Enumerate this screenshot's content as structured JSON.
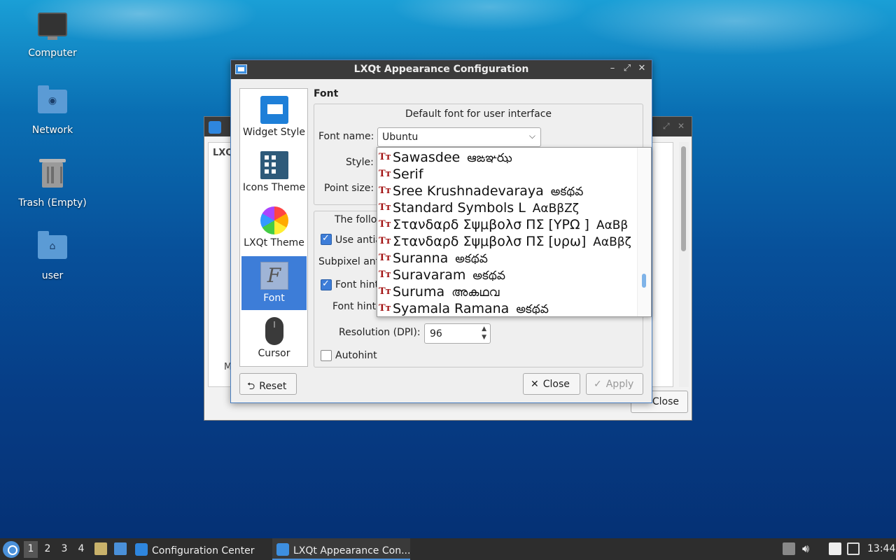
{
  "desktop": {
    "icons": [
      {
        "label": "Computer"
      },
      {
        "label": "Network"
      },
      {
        "label": "Trash (Empty)"
      },
      {
        "label": "user"
      }
    ]
  },
  "back_window": {
    "title_text": "LXQ",
    "label_m": "M",
    "close_label": "Close"
  },
  "dialog": {
    "title": "LXQt Appearance Configuration",
    "controls": {
      "minimize": "–",
      "maximize": "⤢",
      "close": "✕"
    },
    "sidebar": [
      {
        "label": "Widget Style",
        "icon": "widget-style-icon"
      },
      {
        "label": "Icons Theme",
        "icon": "icons-theme-icon"
      },
      {
        "label": "LXQt Theme",
        "icon": "lxqt-theme-icon"
      },
      {
        "label": "Font",
        "icon": "font-icon",
        "selected": true
      },
      {
        "label": "Cursor",
        "icon": "cursor-icon"
      }
    ],
    "section_title": "Font",
    "default_font_group": "Default font for user interface",
    "font_name_label": "Font name:",
    "font_name_value": "Ubuntu",
    "style_label": "Style:",
    "point_size_label": "Point size:",
    "following_text": "The follo",
    "use_antialias_label": "Use antia",
    "use_antialias_checked": true,
    "subpixel_label": "Subpixel ant",
    "font_hinting_label": "Font hint",
    "font_hinting_checked": true,
    "font_hint_style_label": "Font hint",
    "resolution_label": "Resolution (DPI):",
    "resolution_value": "96",
    "autohint_label": "Autohint",
    "autohint_checked": false,
    "reset_label": "Reset",
    "close_label": "Close",
    "apply_label": "Apply",
    "font_list": [
      {
        "name": "Sawasdee",
        "sample": "ఆఙఞఝ"
      },
      {
        "name": "Serif",
        "sample": ""
      },
      {
        "name": "Sree Krushnadevaraya",
        "sample": "అకథవ"
      },
      {
        "name": "Standard Symbols L",
        "sample": "ΑαΒβΖζ"
      },
      {
        "name": "Στανδαρδ Σψμβολσ ΠΣ [ΥΡΩ ]",
        "sample": "ΑαΒβ"
      },
      {
        "name": "Στανδαρδ Σψμβολσ ΠΣ [υρω]",
        "sample": "ΑαΒβζ"
      },
      {
        "name": "Suranna",
        "sample": "అకథవ"
      },
      {
        "name": "Suravaram",
        "sample": "అకథవ"
      },
      {
        "name": "Suruma",
        "sample": "അകഥവ"
      },
      {
        "name": "Syamala Ramana",
        "sample": "అకథవ"
      }
    ]
  },
  "taskbar": {
    "desktops": [
      "1",
      "2",
      "3",
      "4"
    ],
    "tasks": [
      {
        "label": "Configuration Center"
      },
      {
        "label": "LXQt Appearance Con..."
      }
    ],
    "clock": "13:44"
  }
}
